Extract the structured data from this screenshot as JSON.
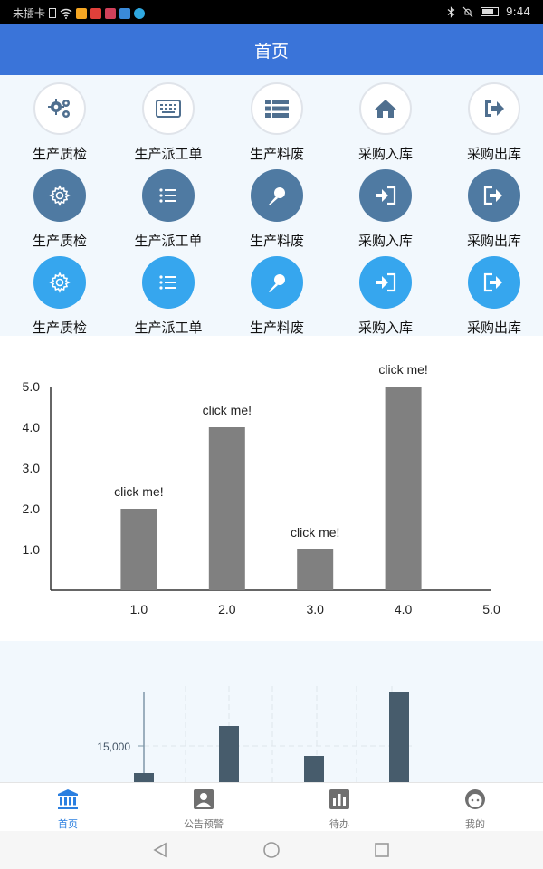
{
  "status_bar": {
    "carrier": "未插卡",
    "time": "9:44"
  },
  "header": {
    "title": "首页"
  },
  "grid": {
    "labels": [
      "生产质检",
      "生产派工单",
      "生产料废",
      "采购入库",
      "采购出库"
    ],
    "rows": [
      {
        "style": "white",
        "icons": [
          "gears-icon",
          "keyboard-icon",
          "list-icon",
          "home-icon",
          "sign-out-icon"
        ]
      },
      {
        "style": "dark",
        "icons": [
          "cog-icon",
          "list-icon",
          "pin-icon",
          "sign-in-icon",
          "sign-out-icon"
        ]
      },
      {
        "style": "light",
        "icons": [
          "cog-icon",
          "list-icon",
          "pin-icon",
          "sign-in-icon",
          "sign-out-icon"
        ]
      }
    ],
    "colors": {
      "white_fill": "#ffffff",
      "dark_fill": "#4f7aa2",
      "light_fill": "#36a6ee"
    }
  },
  "chart_data": [
    {
      "type": "bar",
      "x": [
        1.0,
        2.0,
        3.0,
        4.0
      ],
      "values": [
        2.0,
        4.0,
        1.0,
        5.0
      ],
      "data_labels": [
        "click me!",
        "click me!",
        "click me!",
        "click me!"
      ],
      "x_ticks": [
        "1.0",
        "2.0",
        "3.0",
        "4.0",
        "5.0"
      ],
      "y_ticks": [
        "1.0",
        "2.0",
        "3.0",
        "4.0",
        "5.0"
      ],
      "xlim": [
        0,
        5
      ],
      "ylim": [
        0,
        5
      ],
      "bar_color": "#808080",
      "grid": false
    },
    {
      "type": "bar",
      "y_ticks": [
        "15,000"
      ],
      "values_visible_fraction": [
        0.1,
        0.62,
        0.29,
        1.0
      ],
      "bar_color": "#475c6c",
      "grid": true
    }
  ],
  "tabs": [
    {
      "label": "首页",
      "icon": "bank-icon",
      "active": true
    },
    {
      "label": "公告预警",
      "icon": "user-card-icon",
      "active": false
    },
    {
      "label": "待办",
      "icon": "bar-chart-icon",
      "active": false
    },
    {
      "label": "我的",
      "icon": "face-icon",
      "active": false
    }
  ],
  "colors": {
    "header_bg": "#3a74d9",
    "tab_active": "#2b7fe0",
    "tab_inactive": "#777777"
  }
}
